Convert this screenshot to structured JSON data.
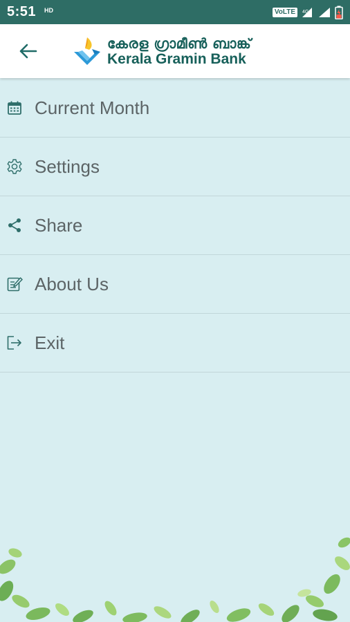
{
  "status_bar": {
    "time": "5:51",
    "hd": "HD",
    "volte": "VoLTE"
  },
  "header": {
    "logo_malayalam": "കേരള ഗ്രാമീൺ ബാങ്ക്",
    "logo_english": "Kerala Gramin Bank"
  },
  "menu": {
    "items": [
      {
        "label": "Current Month",
        "icon": "calendar-icon"
      },
      {
        "label": "Settings",
        "icon": "gear-icon"
      },
      {
        "label": "Share",
        "icon": "share-icon"
      },
      {
        "label": "About Us",
        "icon": "edit-document-icon"
      },
      {
        "label": "Exit",
        "icon": "exit-icon"
      }
    ]
  },
  "colors": {
    "status_bar": "#2e6d65",
    "background": "#d8eef1",
    "icon": "#2f6e6a",
    "text": "#5c6466",
    "brand": "#17605a"
  }
}
